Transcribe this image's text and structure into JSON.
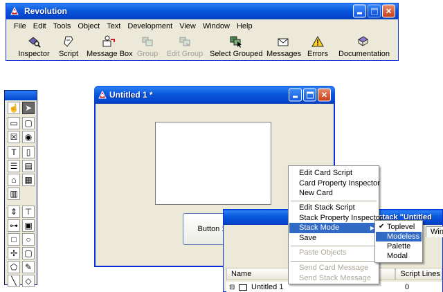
{
  "main_window": {
    "title": "Revolution",
    "menus": [
      "File",
      "Edit",
      "Tools",
      "Object",
      "Text",
      "Development",
      "View",
      "Window",
      "Help"
    ],
    "toolbar": [
      {
        "label": "Inspector",
        "icon": "inspector-icon",
        "enabled": true
      },
      {
        "label": "Script",
        "icon": "script-icon",
        "enabled": true
      },
      {
        "label": "Message Box",
        "icon": "message-box-icon",
        "enabled": true
      },
      {
        "label": "Group",
        "icon": "group-icon",
        "enabled": false
      },
      {
        "label": "Edit Group",
        "icon": "edit-group-icon",
        "enabled": false
      },
      {
        "label": "Select Grouped",
        "icon": "select-grouped-icon",
        "enabled": true
      },
      {
        "label": "Messages",
        "icon": "messages-envelope-icon",
        "enabled": true
      },
      {
        "label": "Errors",
        "icon": "errors-warning-icon",
        "enabled": true
      },
      {
        "label": "Documentation",
        "icon": "documentation-book-icon",
        "enabled": true
      }
    ]
  },
  "stack_window": {
    "title": "Untitled 1 *",
    "button_label": "Button 1"
  },
  "app_browser": {
    "title_fragment": "of stack \"Untitled",
    "tabs": [
      "es",
      "Win"
    ],
    "columns": [
      "Name",
      "Script Lines"
    ],
    "rows": [
      {
        "name": "Untitled 1",
        "script_lines": "0"
      }
    ]
  },
  "context_menu": {
    "items": [
      {
        "label": "Edit Card Script",
        "state": "normal"
      },
      {
        "label": "Card Property Inspector",
        "state": "normal"
      },
      {
        "label": "New Card",
        "state": "normal"
      },
      {
        "label": "Edit Stack Script",
        "state": "normal"
      },
      {
        "label": "Stack Property Inspector",
        "state": "normal"
      },
      {
        "label": "Stack Mode",
        "state": "highlighted"
      },
      {
        "label": "Save",
        "state": "normal"
      },
      {
        "label": "Paste Objects",
        "state": "disabled"
      },
      {
        "label": "Send Card Message",
        "state": "disabled"
      },
      {
        "label": "Send Stack Message",
        "state": "disabled"
      }
    ],
    "submenu": [
      {
        "label": "Toplevel",
        "checked": true
      },
      {
        "label": "Modeless",
        "checked": false,
        "highlighted": true
      },
      {
        "label": "Palette",
        "checked": false
      },
      {
        "label": "Modal",
        "checked": false
      }
    ]
  },
  "colors": {
    "title_bar": "#0346cf",
    "window_bg": "#ece9d8",
    "menu_highlight": "#316ac5",
    "disabled_text": "#aca899"
  }
}
